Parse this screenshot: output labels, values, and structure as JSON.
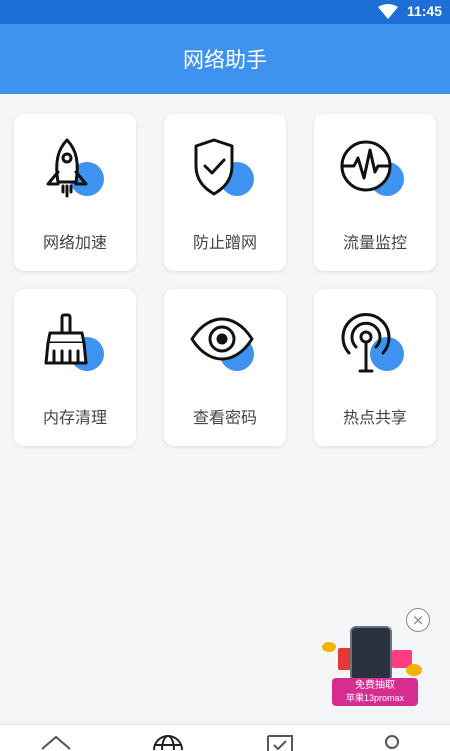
{
  "status_bar": {
    "time": "11:45"
  },
  "header": {
    "title": "网络助手"
  },
  "features": [
    {
      "label": "网络加速",
      "icon": "rocket-icon"
    },
    {
      "label": "防止蹭网",
      "icon": "shield-check-icon"
    },
    {
      "label": "流量监控",
      "icon": "pulse-monitor-icon"
    },
    {
      "label": "内存清理",
      "icon": "broom-icon"
    },
    {
      "label": "查看密码",
      "icon": "eye-icon"
    },
    {
      "label": "热点共享",
      "icon": "hotspot-icon"
    }
  ],
  "ad": {
    "line1": "免费抽取",
    "line2": "苹果13promax",
    "close": "×"
  },
  "bottom_nav": [
    {
      "icon": "home-icon"
    },
    {
      "icon": "globe-icon"
    },
    {
      "icon": "shield-icon"
    },
    {
      "icon": "user-icon"
    }
  ],
  "colors": {
    "accent": "#3f93f0",
    "status_bar": "#1d6fd6",
    "background": "#f5f6f8"
  }
}
